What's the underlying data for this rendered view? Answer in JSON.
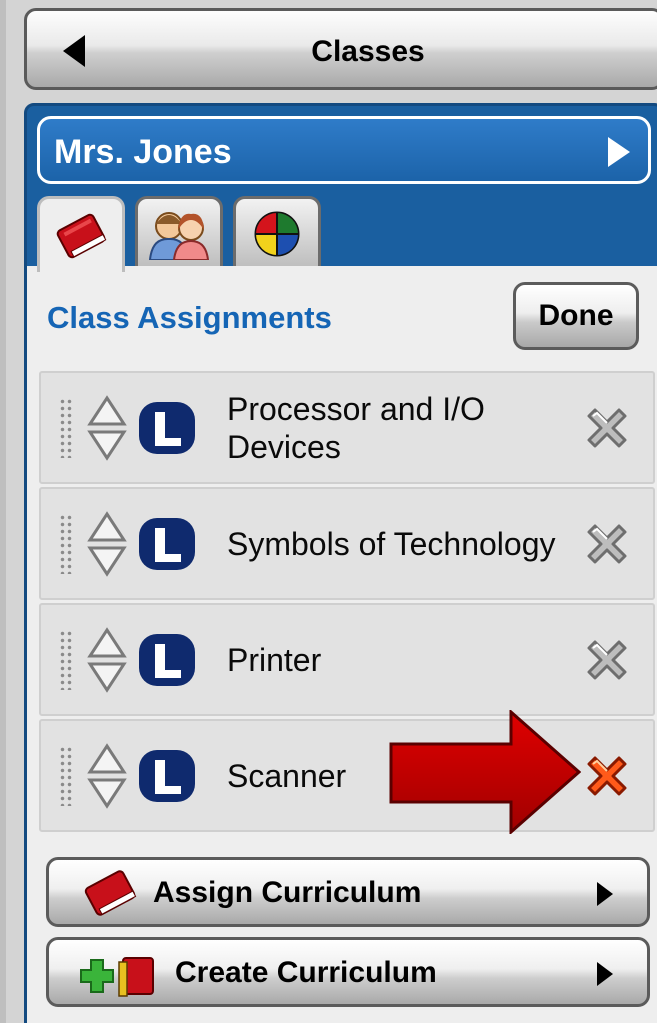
{
  "header": {
    "title": "Classes"
  },
  "teacher": {
    "name": "Mrs. Jones"
  },
  "tabs": [
    {
      "icon": "book-icon"
    },
    {
      "icon": "students-icon"
    },
    {
      "icon": "pie-chart-icon"
    }
  ],
  "section": {
    "title": "Class Assignments",
    "done_label": "Done"
  },
  "assignments": [
    {
      "label": "Processor and I/O Devices",
      "badge": "L",
      "remove_state": "gray"
    },
    {
      "label": "Symbols of Technology",
      "badge": "L",
      "remove_state": "gray"
    },
    {
      "label": "Printer",
      "badge": "L",
      "remove_state": "gray"
    },
    {
      "label": "Scanner",
      "badge": "L",
      "remove_state": "red"
    }
  ],
  "actions": {
    "assign_label": "Assign Curriculum",
    "create_label": "Create Curriculum"
  },
  "colors": {
    "panel_blue": "#1a5fa0",
    "title_blue": "#1565b5",
    "badge_navy": "#0f2a6e",
    "highlight_red": "#d80000"
  }
}
